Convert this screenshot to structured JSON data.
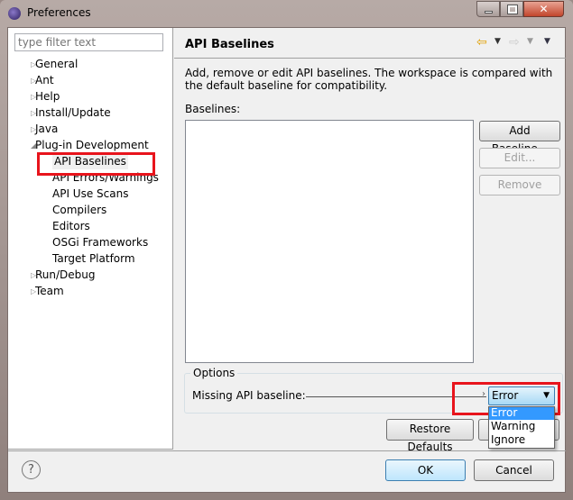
{
  "window": {
    "title": "Preferences",
    "controls": [
      "minimize",
      "maximize",
      "close"
    ]
  },
  "filter": {
    "placeholder": "type filter text",
    "value": ""
  },
  "tree": [
    {
      "label": "General",
      "level": 0,
      "expanded": false
    },
    {
      "label": "Ant",
      "level": 0,
      "expanded": false
    },
    {
      "label": "Help",
      "level": 0,
      "expanded": false
    },
    {
      "label": "Install/Update",
      "level": 0,
      "expanded": false
    },
    {
      "label": "Java",
      "level": 0,
      "expanded": false
    },
    {
      "label": "Plug-in Development",
      "level": 0,
      "expanded": true
    },
    {
      "label": "API Baselines",
      "level": 1,
      "selected": true
    },
    {
      "label": "API Errors/Warnings",
      "level": 1
    },
    {
      "label": "API Use Scans",
      "level": 1
    },
    {
      "label": "Compilers",
      "level": 1
    },
    {
      "label": "Editors",
      "level": 1
    },
    {
      "label": "OSGi Frameworks",
      "level": 1
    },
    {
      "label": "Target Platform",
      "level": 1
    },
    {
      "label": "Run/Debug",
      "level": 0,
      "expanded": false
    },
    {
      "label": "Team",
      "level": 0,
      "expanded": false
    }
  ],
  "page": {
    "title": "API Baselines",
    "description": "Add, remove or edit API baselines. The workspace is compared with the default baseline for compatibility.",
    "baselines_label": "Baselines:",
    "buttons": {
      "add": "Add Baseline...",
      "edit": "Edit...",
      "remove": "Remove"
    },
    "options": {
      "group_label": "Options",
      "missing_label": "Missing API baseline:",
      "selected": "Error",
      "dropdown_options": [
        "Error",
        "Warning",
        "Ignore"
      ]
    },
    "restore_defaults": "Restore Defaults"
  },
  "footer": {
    "ok": "OK",
    "cancel": "Cancel"
  },
  "colors": {
    "highlight": "#e8141c",
    "selection": "#3399ff"
  }
}
